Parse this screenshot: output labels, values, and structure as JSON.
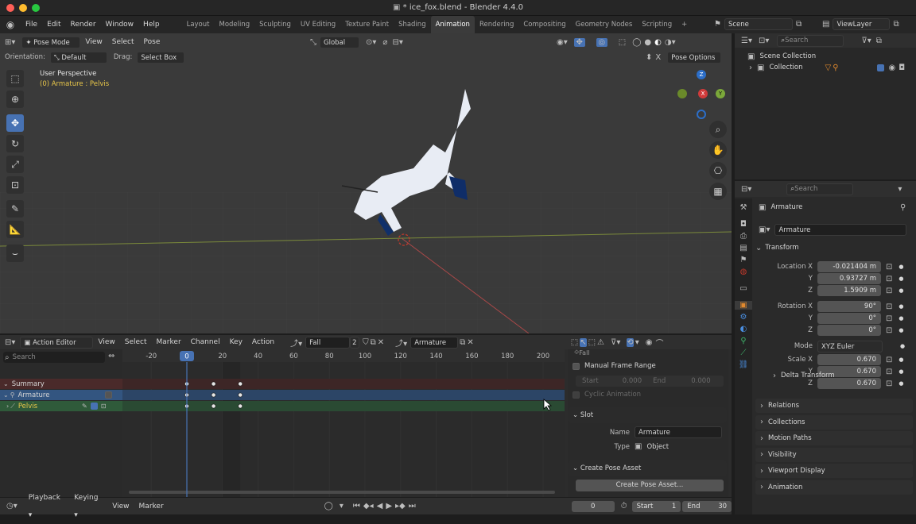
{
  "window": {
    "title": "* ice_fox.blend - Blender 4.4.0",
    "file_icon": "file-icon"
  },
  "menu": [
    "File",
    "Edit",
    "Render",
    "Window",
    "Help"
  ],
  "workspaces": [
    "Layout",
    "Modeling",
    "Sculpting",
    "UV Editing",
    "Texture Paint",
    "Shading",
    "Animation",
    "Rendering",
    "Compositing",
    "Geometry Nodes",
    "Scripting"
  ],
  "active_workspace": "Animation",
  "scene": "Scene",
  "view_layer": "ViewLayer",
  "viewport": {
    "mode": "Pose Mode",
    "menus": [
      "View",
      "Select",
      "Pose"
    ],
    "orientation_label": "Orientation:",
    "orientation": "Default",
    "drag_label": "Drag:",
    "drag": "Select Box",
    "transform_orientation": "Global",
    "pose_options": "Pose Options",
    "close_x": "X",
    "perspective": "User Perspective",
    "active": "(0) Armature : Pelvis",
    "gizmo": {
      "z": "Z",
      "y": "Y",
      "x": "X"
    }
  },
  "outliner": {
    "search_placeholder": "Search",
    "scene_collection": "Scene Collection",
    "collection": "Collection"
  },
  "properties": {
    "search_placeholder": "Search",
    "object": "Armature",
    "data_name": "Armature",
    "transform_title": "Transform",
    "location_label": "Location",
    "rotation_label": "Rotation",
    "mode_label": "Mode",
    "scale_label": "Scale",
    "axes": [
      "X",
      "Y",
      "Z"
    ],
    "location": [
      "-0.021404 m",
      "0.93727 m",
      "1.5909 m"
    ],
    "rotation": [
      "90°",
      "0°",
      "0°"
    ],
    "mode": "XYZ Euler",
    "scale": [
      "0.670",
      "0.670",
      "0.670"
    ],
    "collapsed": [
      "Delta Transform",
      "Relations",
      "Collections",
      "Motion Paths",
      "Visibility",
      "Viewport Display",
      "Animation"
    ]
  },
  "action_editor": {
    "editor_type": "Action Editor",
    "menus": [
      "View",
      "Select",
      "Marker",
      "Channel",
      "Key",
      "Action"
    ],
    "action_name": "Fall",
    "users": "2",
    "slot_name": "Armature",
    "search_placeholder": "Search",
    "frame_ticks": [
      "-20",
      "0",
      "20",
      "40",
      "60",
      "80",
      "100",
      "120",
      "140",
      "160",
      "180",
      "200"
    ],
    "current_frame": "0",
    "channels": [
      "Summary",
      "Armature",
      "Pelvis"
    ],
    "sidebar": {
      "action_label": "Fall",
      "manual_range": "Manual Frame Range",
      "start_label": "Start",
      "start_val": "0.000",
      "end_label": "End",
      "end_val": "0.000",
      "cyclic": "Cyclic Animation",
      "slot_title": "Slot",
      "name_label": "Name",
      "name_val": "Armature",
      "type_label": "Type",
      "type_val": "Object",
      "pose_asset_title": "Create Pose Asset",
      "pose_asset_button": "Create Pose Asset..."
    }
  },
  "timeline": {
    "menus": [
      "Playback",
      "Keying",
      "View",
      "Marker"
    ],
    "frame": "0",
    "start_label": "Start",
    "start": "1",
    "end_label": "End",
    "end": "30"
  },
  "keyframes": [
    0,
    15,
    30
  ],
  "colors": {
    "accent": "#4772b3",
    "active_tab": "#3b3b3b",
    "summary_row": "#4a2a2a",
    "armature_row": "#335580",
    "pelvis_row": "#2f5a3a",
    "playhead": "#4772b3",
    "selected_text": "#e8c64a"
  }
}
